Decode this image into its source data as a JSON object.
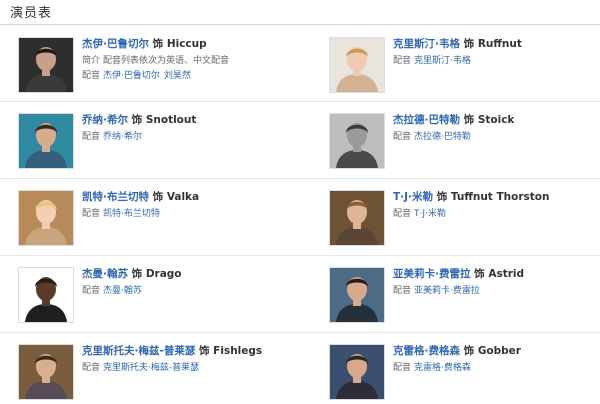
{
  "page": {
    "title": "演员表"
  },
  "cast": [
    {
      "actor": "杰伊·巴鲁切尔",
      "shi": "饰",
      "role": "Hiccup",
      "intro_label": "简介",
      "intro": "配音列表依次为英语、中文配音",
      "dub_label": "配音",
      "dubs": [
        "杰伊·巴鲁切尔",
        "刘昊然"
      ],
      "colors": {
        "bg": "#2e2e2e",
        "skin": "#c8a08a",
        "hair": "#1e1a18",
        "cloth": "#3a3a3a"
      }
    },
    {
      "actor": "克里斯汀·韦格",
      "shi": "饰",
      "role": "Ruffnut",
      "dub_label": "配音",
      "dubs": [
        "克里斯汀·韦格"
      ],
      "colors": {
        "bg": "#e9e4de",
        "skin": "#efc9b0",
        "hair": "#c99b55",
        "cloth": "#d3b293"
      }
    },
    {
      "actor": "乔纳·希尔",
      "shi": "饰",
      "role": "Snotlout",
      "dub_label": "配音",
      "dubs": [
        "乔纳·希尔"
      ],
      "colors": {
        "bg": "#2f8aa1",
        "skin": "#d9ab8d",
        "hair": "#3a2a20",
        "cloth": "#345f7c"
      }
    },
    {
      "actor": "杰拉德·巴特勒",
      "shi": "饰",
      "role": "Stoick",
      "dub_label": "配音",
      "dubs": [
        "杰拉德·巴特勒"
      ],
      "colors": {
        "bg": "#bdbdbd",
        "skin": "#9a9a9a",
        "hair": "#3a3a3a",
        "cloth": "#4a4a4a"
      }
    },
    {
      "actor": "凯特·布兰切特",
      "shi": "饰",
      "role": "Valka",
      "dub_label": "配音",
      "dubs": [
        "凯特·布兰切特"
      ],
      "colors": {
        "bg": "#b78a58",
        "skin": "#f0cfb3",
        "hair": "#e6c487",
        "cloth": "#c8a57c"
      }
    },
    {
      "actor": "T·J·米勒",
      "shi": "饰",
      "role": "Tuffnut Thorston",
      "dub_label": "配音",
      "dubs": [
        "T·J·米勒"
      ],
      "colors": {
        "bg": "#6d5236",
        "skin": "#e1b497",
        "hair": "#8a6030",
        "cloth": "#5a4636"
      }
    },
    {
      "actor": "杰曼·翰苏",
      "shi": "饰",
      "role": "Drago",
      "dub_label": "配音",
      "dubs": [
        "杰曼·翰苏"
      ],
      "colors": {
        "bg": "#ffffff",
        "skin": "#5b3a29",
        "hair": "#2a1b14",
        "cloth": "#1f1f1f"
      }
    },
    {
      "actor": "亚美莉卡·费雷拉",
      "shi": "饰",
      "role": "Astrid",
      "dub_label": "配音",
      "dubs": [
        "亚美莉卡·费雷拉"
      ],
      "colors": {
        "bg": "#4c6b84",
        "skin": "#d8a98a",
        "hair": "#2a1c16",
        "cloth": "#26303b"
      }
    },
    {
      "actor": "克里斯托夫·梅兹-普莱瑟",
      "shi": "饰",
      "role": "Fishlegs",
      "dub_label": "配音",
      "dubs": [
        "克里斯托夫·梅兹-普莱瑟"
      ],
      "colors": {
        "bg": "#7a5d3e",
        "skin": "#d9b08f",
        "hair": "#3c2c1e",
        "cloth": "#564c55"
      }
    },
    {
      "actor": "克雷格·费格森",
      "shi": "饰",
      "role": "Gobber",
      "dub_label": "配音",
      "dubs": [
        "克雷格·费格森"
      ],
      "colors": {
        "bg": "#3b4f73",
        "skin": "#d8a88a",
        "hair": "#2a2424",
        "cloth": "#2d2d38"
      }
    }
  ]
}
